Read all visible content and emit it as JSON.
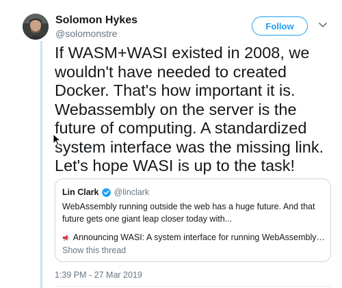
{
  "author": {
    "name": "Solomon Hykes",
    "handle": "@solomonstre",
    "avatar_icon": "avatar-photo"
  },
  "follow_button": {
    "label": "Follow",
    "color": "#1da1f2"
  },
  "menu_icon": "chevron-down-icon",
  "tweet": {
    "text": "If WASM+WASI existed in 2008, we wouldn't have needed to created Docker. That's how important it is. Webassembly on the server is the future of computing. A standardized system interface was the missing link. Let's hope WASI is up to the task!"
  },
  "quoted_tweet": {
    "author_name": "Lin Clark",
    "verified_icon": "verified-badge-icon",
    "author_handle": "@linclark",
    "text": "WebAssembly running outside the web has a huge future. And that future gets one giant leap closer today with...",
    "link_icon": "megaphone-icon",
    "link_text": "Announcing WASI: A system interface for running WebAssembly…",
    "show_thread": "Show this thread"
  },
  "timestamp": "1:39 PM - 27 Mar 2019",
  "colors": {
    "text": "#14171a",
    "secondary": "#657786",
    "accent": "#1da1f2",
    "thread_line": "#c6e3f6",
    "border": "#ccd6dd"
  }
}
